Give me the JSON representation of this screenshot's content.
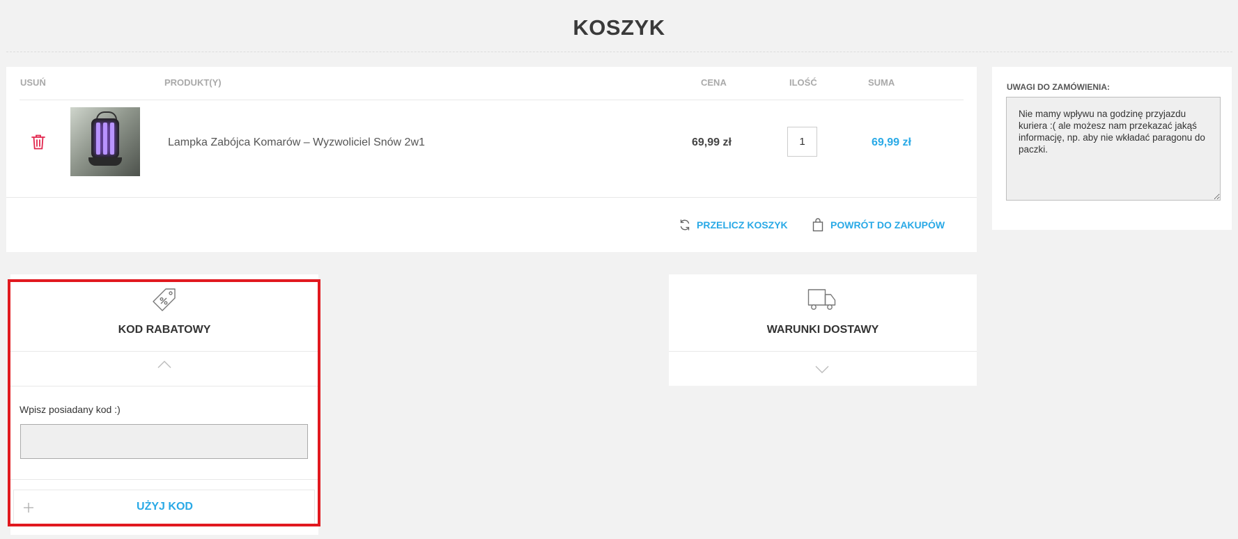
{
  "page": {
    "title": "KOSZYK"
  },
  "cart": {
    "headers": {
      "remove": "USUŃ",
      "product": "PRODUKT(Y)",
      "price": "CENA",
      "quantity": "ILOŚĆ",
      "total": "SUMA"
    },
    "items": [
      {
        "name": "Lampka Zabójca Komarów – Wyzwoliciel Snów 2w1",
        "price": "69,99 zł",
        "quantity": "1",
        "total": "69,99 zł"
      }
    ],
    "actions": {
      "recalculate": "PRZELICZ KOSZYK",
      "back_to_shop": "POWRÓT DO ZAKUPÓW"
    }
  },
  "notes": {
    "label": "UWAGI DO ZAMÓWIENIA:",
    "value": "Nie mamy wpływu na godzinę przyjazdu kuriera :( ale możesz nam przekazać jakąś informację, np. aby nie wkładać paragonu do paczki."
  },
  "discount": {
    "title": "KOD RABATOWY",
    "input_label": "Wpisz posiadany kod :)",
    "input_value": "",
    "button_label": "UŻYJ KOD"
  },
  "shipping": {
    "title": "WARUNKI DOSTAWY"
  },
  "colors": {
    "accent": "#29a9e6",
    "remove": "#e2264d",
    "highlight": "#e1191f"
  },
  "icons": {
    "remove": "trash-icon",
    "recalculate": "refresh-icon",
    "back": "shopping-bag-icon",
    "discount": "price-tag-icon",
    "shipping": "truck-icon"
  }
}
